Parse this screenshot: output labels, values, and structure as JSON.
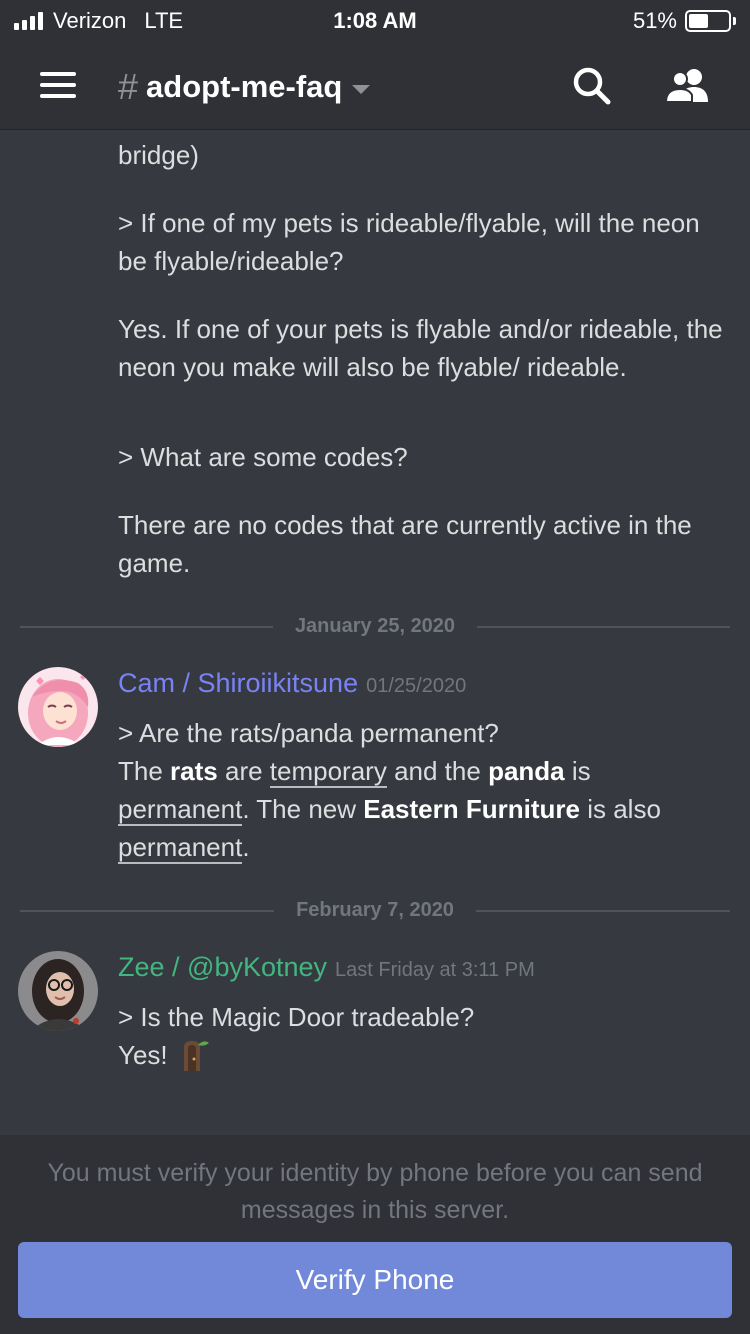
{
  "status_bar": {
    "carrier": "Verizon",
    "network": "LTE",
    "time": "1:08 AM",
    "battery_percent": "51%",
    "battery_level": 0.51,
    "signal_bars": 4
  },
  "header": {
    "hash": "#",
    "channel_name": "adopt-me-faq",
    "icons": [
      "menu-icon",
      "search-icon",
      "members-icon"
    ]
  },
  "messages": {
    "continued": {
      "fragment": "bridge)",
      "q1": "> If one of my pets is rideable/flyable, will the neon be flyable/rideable?",
      "a1": "Yes. If one of your pets is flyable and/or rideable, the neon you make will also be flyable/ rideable.",
      "q2": "> What are some codes?",
      "a2": "There are no codes that are currently active in the game."
    },
    "divider1": "January 25, 2020",
    "msg1": {
      "author": "Cam / Shiroiikitsune",
      "author_color": "#7983f5",
      "timestamp": "01/25/2020",
      "line1": "> Are the rats/panda permanent?",
      "t_the": "The",
      "t_rats": "rats",
      "t_are": "are",
      "t_temporary": "temporary",
      "t_and_the": "and the",
      "t_panda": "panda",
      "t_is": "is",
      "t_permanent1": "permanent",
      "t_the_new": ". The new",
      "t_eastern": "Eastern Furniture",
      "t_is_also": "is also",
      "t_permanent2": "permanent",
      "t_end": "."
    },
    "divider2": "February 7, 2020",
    "msg2": {
      "author": "Zee / @byKotney",
      "author_color": "#43b581",
      "timestamp": "Last Friday at 3:11 PM",
      "line1": "> Is the Magic Door tradeable?",
      "line2": "Yes!",
      "emoji": "door-emoji"
    }
  },
  "footer": {
    "note": "You must verify your identity by phone before you can send messages in this server.",
    "button_label": "Verify Phone",
    "button_color": "#7289da"
  }
}
